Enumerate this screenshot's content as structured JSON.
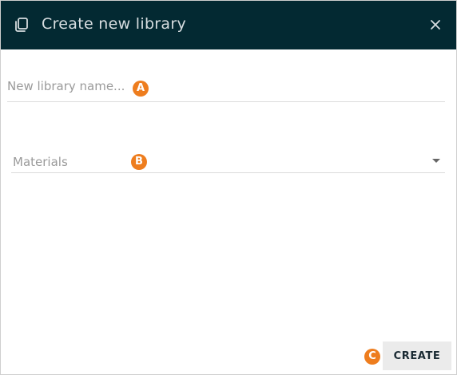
{
  "dialog": {
    "title": "Create new library",
    "title_icon": "library-icon",
    "close_icon": "close-icon",
    "header_color": "#032932"
  },
  "name_field": {
    "placeholder": "New library name...",
    "value": "",
    "badge": "A"
  },
  "type_select": {
    "selected": "Materials",
    "caret_icon": "caret-down-icon",
    "badge": "B"
  },
  "footer": {
    "create_label": "CREATE",
    "badge": "C"
  },
  "colors": {
    "badge": "#ee7d1e",
    "button_bg": "#ebebeb"
  }
}
